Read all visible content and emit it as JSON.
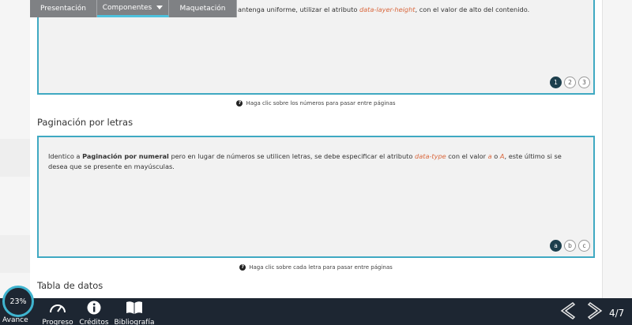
{
  "topnav": {
    "tabs": [
      {
        "label": "Presentación",
        "active": false
      },
      {
        "label": "Componentes",
        "active": true
      },
      {
        "label": "Maquetación",
        "active": false
      }
    ]
  },
  "section_numeral": {
    "text_tail_prefix": "antenga uniforme, utilizar el atributo ",
    "attr": "data-layer-height",
    "text_tail_suffix": ", con el valor de alto del contenido.",
    "pages": [
      "1",
      "2",
      "3"
    ],
    "active_page": "1",
    "hint": "Haga clic sobre los números para pasar entre páginas"
  },
  "section_letters": {
    "heading": "Paginación por letras",
    "p1": "Identico a ",
    "p1_bold": "Paginación por numeral",
    "p1_mid": " pero en lugar de números se utilicen letras, se debe especificar el atributo ",
    "p1_attr": "data-type",
    "p1_val": " con el valor ",
    "p1_a": "a",
    "p1_o": " o ",
    "p1_A": "A",
    "p1_end": ", este último si se",
    "p2": "desea que se presente en mayúsculas.",
    "pages": [
      "a",
      "b",
      "c"
    ],
    "active_page": "a",
    "hint": "Haga clic sobre cada letra para pasar entre páginas"
  },
  "section_table": {
    "heading": "Tabla de datos"
  },
  "bottombar": {
    "progress_percent": "23%",
    "avance_label": "Avance",
    "items": [
      {
        "label": "Progreso",
        "icon": "gauge-icon"
      },
      {
        "label": "Créditos",
        "icon": "info-icon"
      },
      {
        "label": "Bibliografía",
        "icon": "book-icon"
      }
    ],
    "page_counter": "4/7"
  },
  "colors": {
    "accent": "#3fa9c2",
    "bar": "#1d2632",
    "tab": "#7f8184",
    "highlight": "#d9683e"
  }
}
